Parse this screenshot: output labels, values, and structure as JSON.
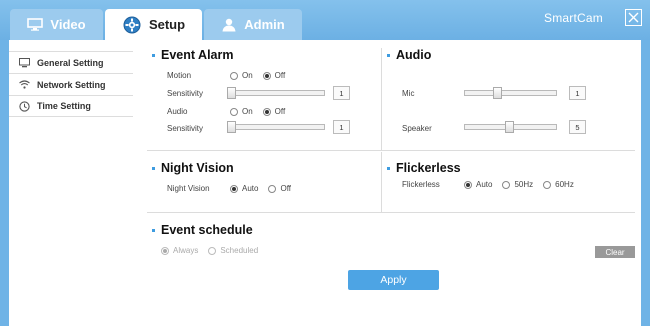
{
  "tabs": [
    {
      "label": "Video",
      "icon": "monitor-icon"
    },
    {
      "label": "Setup",
      "icon": "gear-icon"
    },
    {
      "label": "Admin",
      "icon": "user-icon"
    }
  ],
  "brand": "SmartCam",
  "sidebar": {
    "items": [
      {
        "label": "General Setting",
        "icon": "monitor-icon"
      },
      {
        "label": "Network Setting",
        "icon": "wifi-icon"
      },
      {
        "label": "Time Setting",
        "icon": "clock-icon"
      }
    ]
  },
  "event_alarm": {
    "title": "Event Alarm",
    "motion_label": "Motion",
    "motion_options": [
      "On",
      "Off"
    ],
    "motion_selected": "Off",
    "motion_sensitivity_label": "Sensitivity",
    "motion_sensitivity": "1",
    "audio_label": "Audio",
    "audio_options": [
      "On",
      "Off"
    ],
    "audio_selected": "Off",
    "audio_sensitivity_label": "Sensitivity",
    "audio_sensitivity": "1"
  },
  "audio": {
    "title": "Audio",
    "mic_label": "Mic",
    "mic_value": "1",
    "speaker_label": "Speaker",
    "speaker_value": "5"
  },
  "night_vision": {
    "title": "Night Vision",
    "label": "Night Vision",
    "options": [
      "Auto",
      "Off"
    ],
    "selected": "Auto"
  },
  "flickerless": {
    "title": "Flickerless",
    "label": "Flickerless",
    "options": [
      "Auto",
      "50Hz",
      "60Hz"
    ],
    "selected": "Auto"
  },
  "event_schedule": {
    "title": "Event schedule",
    "options": [
      "Always",
      "Scheduled"
    ],
    "selected": "Always",
    "clear_label": "Clear"
  },
  "apply_label": "Apply",
  "colors": {
    "frame": "#6fb3e6",
    "accent": "#3e9ce0",
    "apply": "#4da4e4",
    "clear": "#999999"
  }
}
